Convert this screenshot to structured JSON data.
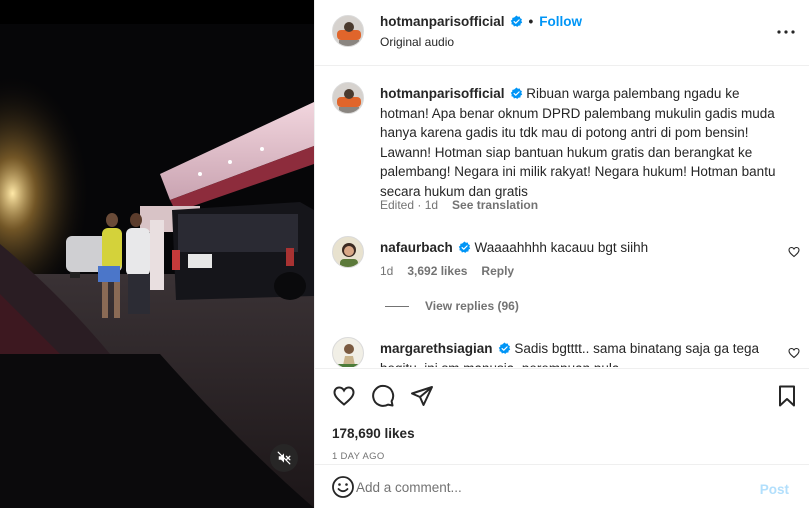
{
  "header": {
    "username": "hotmanparisofficial",
    "separator": "•",
    "follow_label": "Follow",
    "audio": "Original audio",
    "more_icon": "more-horizontal-icon"
  },
  "caption": {
    "username": "hotmanparisofficial",
    "text": "Ribuan warga palembang ngadu ke hotman! Apa benar oknum DPRD palembang mukulin gadis muda hanya karena gadis itu tdk mau di potong antri di pom bensin! Lawann! Hotman siap bantuan hukum gratis dan berangkat ke palembang! Negara ini milik rakyat! Negara hukum! Hotman bantu secara hukum dan gratis",
    "edited": "Edited · 1d",
    "see_translation": "See translation"
  },
  "comments": [
    {
      "username": "nafaurbach",
      "text": "Waaaahhhh kacauu bgt siihh",
      "age": "1d",
      "likes": "3,692 likes",
      "reply_label": "Reply",
      "view_replies": "View replies (96)"
    },
    {
      "username": "margarethsiagian",
      "text": "Sadis bgtttt.. sama binatang saja ga tega begitu, ini sm manusia, perempuan pula"
    }
  ],
  "actions": {
    "likes": "178,690 likes",
    "date": "1 DAY AGO"
  },
  "add_comment": {
    "placeholder": "Add a comment...",
    "post_label": "Post"
  },
  "colors": {
    "accent": "#0095f6",
    "verified": "#0095f6",
    "post_disabled": "#b2dffc"
  }
}
